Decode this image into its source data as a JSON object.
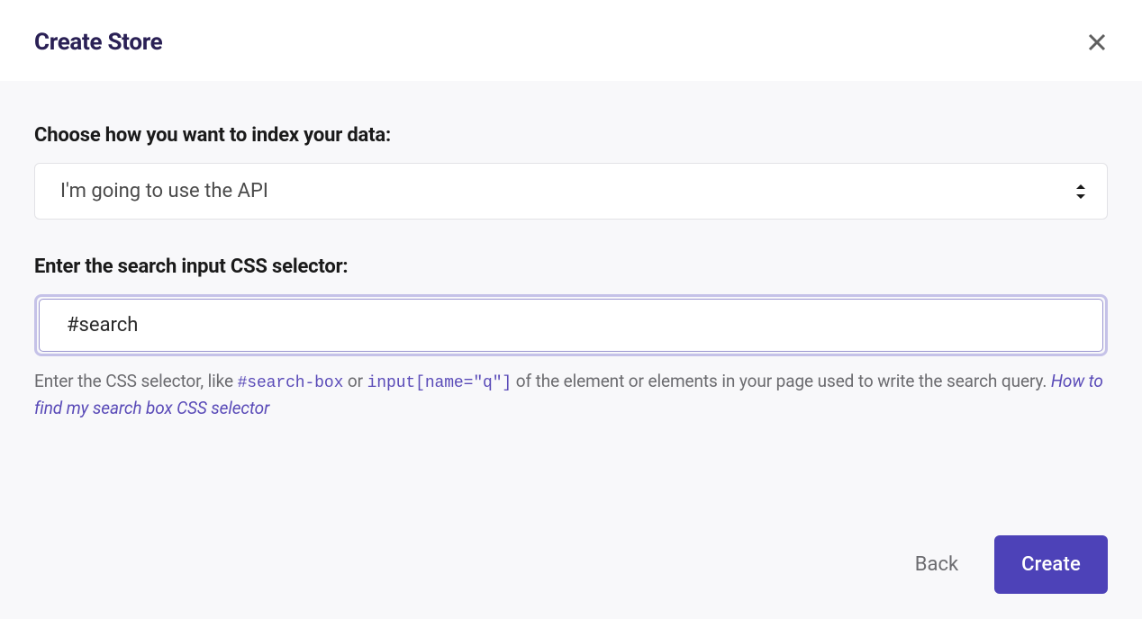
{
  "header": {
    "title": "Create Store"
  },
  "form": {
    "index_label": "Choose how you want to index your data:",
    "index_option_selected": "I'm going to use the API",
    "selector_label": "Enter the search input CSS selector:",
    "selector_value": "#search",
    "help_text_prefix": "Enter the CSS selector, like ",
    "help_code_1": "#search-box",
    "help_text_or": " or ",
    "help_code_2": "input[name=\"q\"]",
    "help_text_suffix": " of the element or elements in your page used to write the search query. ",
    "help_link": "How to find my search box CSS selector"
  },
  "footer": {
    "back_label": "Back",
    "create_label": "Create"
  }
}
